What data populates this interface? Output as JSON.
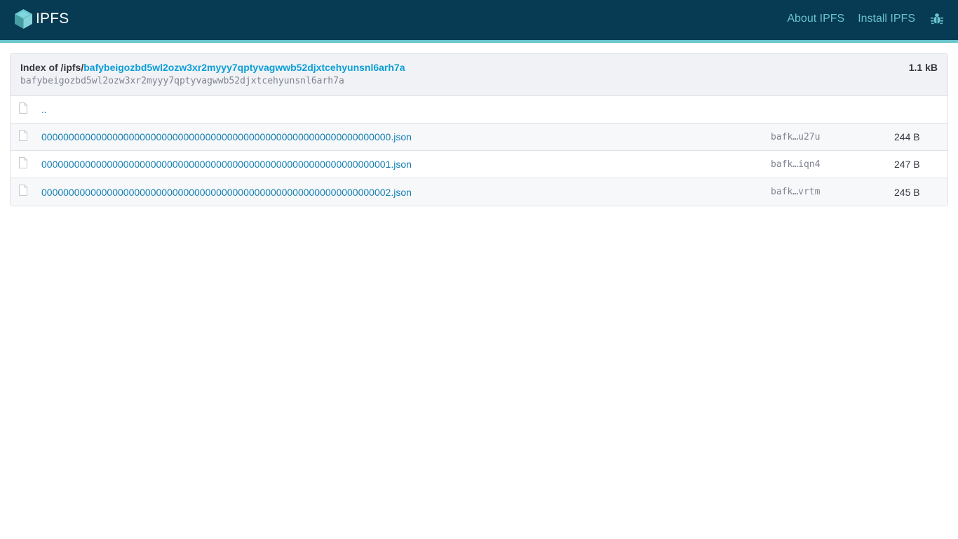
{
  "header": {
    "logo_text": "IPFS",
    "nav": {
      "about": "About IPFS",
      "install": "Install IPFS"
    },
    "colors": {
      "background": "#073a53",
      "accent": "#69c4cd"
    }
  },
  "index": {
    "title_prefix": "Index of /ipfs/",
    "cid": "bafybeigozbd5wl2ozw3xr2myyy7qptyvagwwb52djxtcehyunsnl6arh7a",
    "subtitle_cid": "bafybeigozbd5wl2ozw3xr2myyy7qptyvagwwb52djxtcehyunsnl6arh7a",
    "total_size": "1.1 kB"
  },
  "rows": [
    {
      "name": "..",
      "cid": "",
      "size": "",
      "icon": "file-icon"
    },
    {
      "name": "0000000000000000000000000000000000000000000000000000000000000000.json",
      "cid": "bafk…u27u",
      "size": "244 B",
      "icon": "file-icon"
    },
    {
      "name": "0000000000000000000000000000000000000000000000000000000000000001.json",
      "cid": "bafk…iqn4",
      "size": "247 B",
      "icon": "file-icon"
    },
    {
      "name": "0000000000000000000000000000000000000000000000000000000000000002.json",
      "cid": "bafk…vrtm",
      "size": "245 B",
      "icon": "file-icon"
    }
  ]
}
